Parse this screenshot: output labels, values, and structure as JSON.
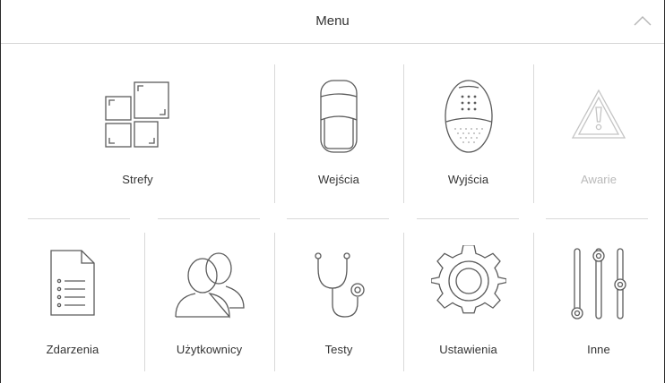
{
  "header": {
    "title": "Menu",
    "collapse_icon": "chevron-up-icon"
  },
  "tiles": [
    {
      "id": "strefy",
      "label": "Strefy",
      "icon": "zones-icon",
      "enabled": true
    },
    {
      "id": "wejscia",
      "label": "Wejścia",
      "icon": "motion-detector-icon",
      "enabled": true
    },
    {
      "id": "wyjscia",
      "label": "Wyjścia",
      "icon": "siren-icon",
      "enabled": true
    },
    {
      "id": "awarie",
      "label": "Awarie",
      "icon": "warning-triangle-icon",
      "enabled": false
    },
    {
      "id": "zdarzenia",
      "label": "Zdarzenia",
      "icon": "document-list-icon",
      "enabled": true
    },
    {
      "id": "uzytkownicy",
      "label": "Użytkownicy",
      "icon": "users-icon",
      "enabled": true
    },
    {
      "id": "testy",
      "label": "Testy",
      "icon": "stethoscope-icon",
      "enabled": true
    },
    {
      "id": "ustawienia",
      "label": "Ustawienia",
      "icon": "gear-icon",
      "enabled": true
    },
    {
      "id": "inne",
      "label": "Inne",
      "icon": "sliders-icon",
      "enabled": true
    }
  ],
  "colors": {
    "icon": "#5a5a5a",
    "icon_disabled": "#c4c4c4",
    "divider": "#d9d9d9",
    "text": "#333333",
    "text_disabled": "#b9b9b9"
  }
}
